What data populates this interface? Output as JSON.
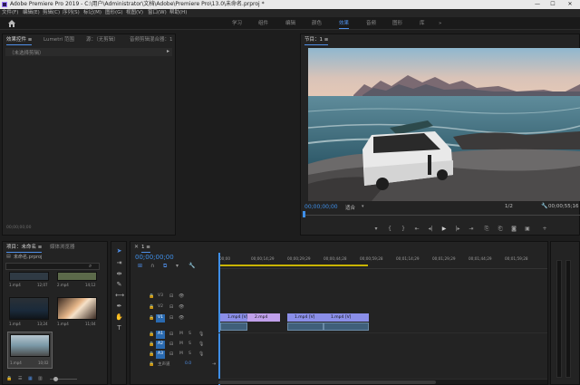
{
  "window": {
    "title": "Adobe Premiere Pro 2019 - C:\\用户\\Administrator\\文档\\Adobe\\Premiere Pro\\13.0\\未命名.prproj *",
    "controls": [
      "—",
      "☐",
      "✕"
    ]
  },
  "menu": [
    "文件(F)",
    "编辑(E)",
    "剪辑(C)",
    "序列(S)",
    "标记(M)",
    "图形(G)",
    "视图(V)",
    "窗口(W)",
    "帮助(H)"
  ],
  "workspaces": {
    "home_icon": "home-icon",
    "tabs": [
      "学习",
      "组件",
      "编辑",
      "颜色",
      "效果",
      "音频",
      "图形",
      "库"
    ],
    "active_index": 4,
    "more": "»"
  },
  "effect_controls": {
    "tabs": [
      "效果控件 ≡",
      "Lumetri 范围",
      "源：（无剪辑）",
      "音频剪辑混合器：1"
    ],
    "empty_label": "（未选择剪辑）",
    "timecode": "00;00;00;00"
  },
  "program": {
    "tab": "节目：1 ≡",
    "timecode": "00;00;00;00",
    "fit": "适合",
    "fraction": "1/2",
    "duration": "00;00;55;16",
    "transport": [
      "▾",
      "{",
      "}",
      "⇤",
      "◂|",
      "▶",
      "|▸",
      "⇥",
      "⎘",
      "⎗",
      "◙",
      "▣"
    ]
  },
  "project": {
    "tabs": [
      "项目：未命名 ≡",
      "媒体浏览器"
    ],
    "file": "未命名.prproj",
    "items": [
      {
        "name": "1.mp4",
        "duration": "12;07"
      },
      {
        "name": "2.mp4",
        "duration": "14;12"
      },
      {
        "name": "1.mp4",
        "duration": "13;24"
      },
      {
        "name": "1.mp4",
        "duration": "11;04"
      },
      {
        "name": "1.mp4",
        "duration": "10;02"
      }
    ]
  },
  "timeline": {
    "tab": "1 ≡",
    "timecode": "00;00;00;00",
    "ruler": [
      "00;00",
      "00;00;14;29",
      "00;00;29;29",
      "00;00;44;28",
      "00;00;59;28",
      "00;01;14;29",
      "00;01;29;29",
      "00;01;44;29",
      "00;01;59;28"
    ],
    "video_tracks": [
      "V3",
      "V2",
      "V1"
    ],
    "audio_tracks": [
      "A1",
      "A2",
      "A3"
    ],
    "master": {
      "label": "主声道",
      "value": "0.0"
    },
    "track_toggles": [
      "M",
      "S"
    ],
    "clips": [
      {
        "label": "1.mp4 [V]",
        "color": "#8a8ee8"
      },
      {
        "label": "2.mp4",
        "color": "#c0a0ea"
      },
      {
        "label": "1.mp4 [V]",
        "color": "#8a8ee8"
      },
      {
        "label": "1.mp4 [V]",
        "color": "#8a8ee8"
      }
    ]
  },
  "colors": {
    "accent": "#4f8fe8",
    "panel_bg": "#232323",
    "app_bg": "#1d1d1d",
    "track_active": "#2a6ab0"
  }
}
